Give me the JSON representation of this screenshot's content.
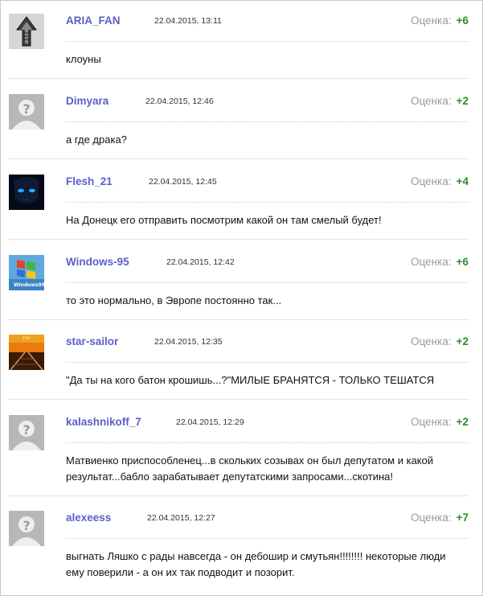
{
  "comments": [
    {
      "author": "ARIA_FAN",
      "date": "22.04.2015, 13:11",
      "rating_label": "Оценка:",
      "score": "+6",
      "text": "клоуны",
      "avatar": "arrow-avatar"
    },
    {
      "author": "Dimyara",
      "date": "22.04.2015, 12:46",
      "rating_label": "Оценка:",
      "score": "+2",
      "text": "а где драка?",
      "avatar": "default-avatar"
    },
    {
      "author": "Flesh_21",
      "date": "22.04.2015, 12:45",
      "rating_label": "Оценка:",
      "score": "+4",
      "text": "На Донецк его отправить посмотрим какой он там смелый будет!",
      "avatar": "panther-avatar"
    },
    {
      "author": "Windows-95",
      "date": "22.04.2015, 12:42",
      "rating_label": "Оценка:",
      "score": "+6",
      "text": "то это нормально, в Эвропе постоянно так...",
      "avatar": "windows95-avatar"
    },
    {
      "author": "star-sailor",
      "date": "22.04.2015, 12:35",
      "rating_label": "Оценка:",
      "score": "+2",
      "text": "\"Да ты на кого батон крошишь...?\"МИЛЫЕ БРАНЯТСЯ - ТОЛЬКО ТЕШАТСЯ",
      "avatar": "railway-sunset-avatar"
    },
    {
      "author": "kalashnikoff_7",
      "date": "22.04.2015, 12:29",
      "rating_label": "Оценка:",
      "score": "+2",
      "text": "Матвиенко приспособленец...в скольких созывах он был депутатом и какой результат...бабло зарабатывает депутатскими запросами...скотина!",
      "avatar": "default-avatar"
    },
    {
      "author": "alexeess",
      "date": "22.04.2015, 12:27",
      "rating_label": "Оценка:",
      "score": "+7",
      "text": "выгнать Ляшко с рады навсегда - он дебошир и смутьян!!!!!!!! некоторые люди ему поверили - а он их так подводит и позорит.",
      "avatar": "default-avatar"
    }
  ]
}
